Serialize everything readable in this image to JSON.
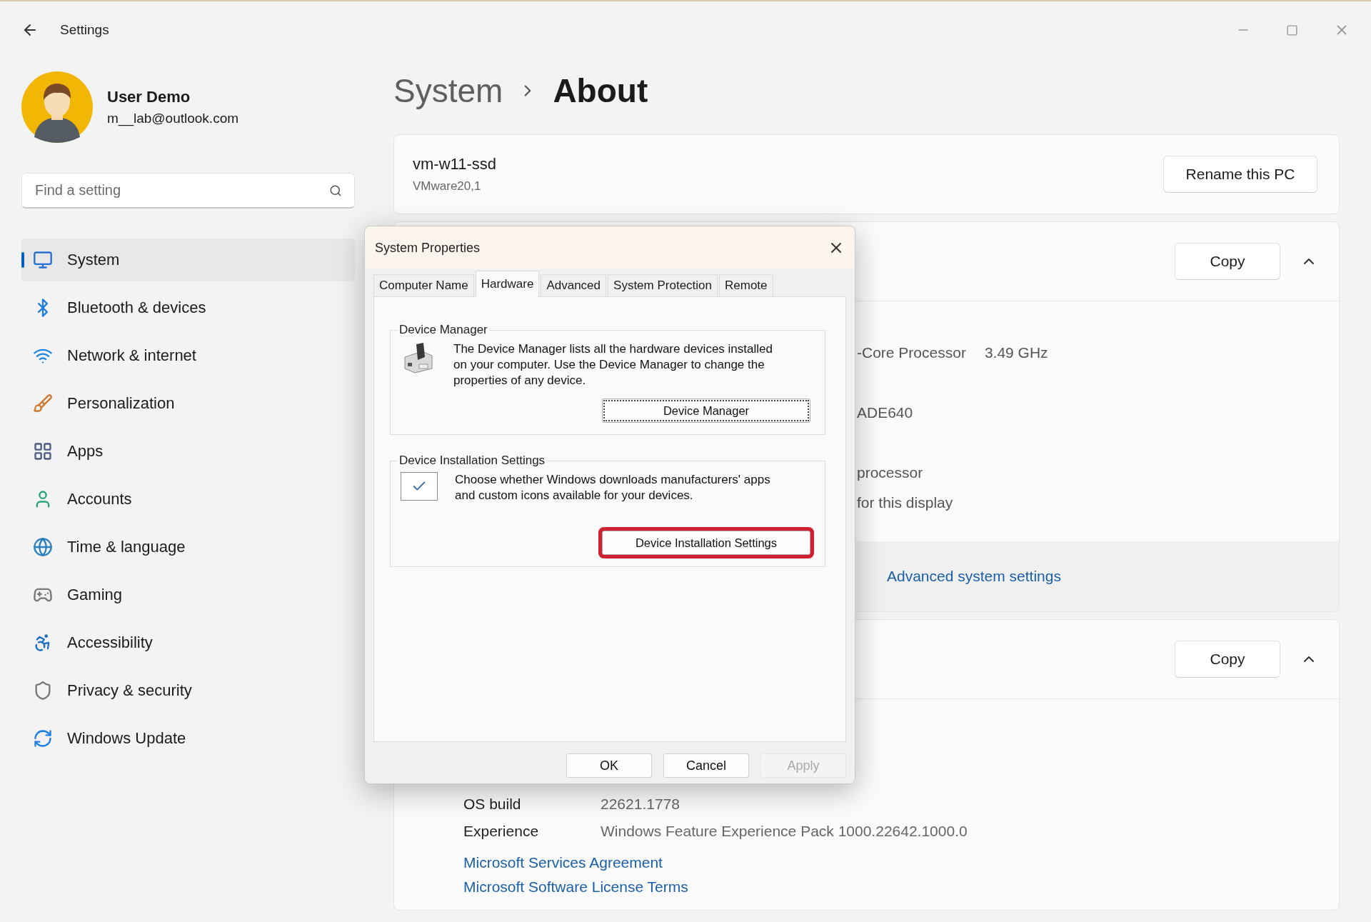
{
  "window": {
    "title": "Settings"
  },
  "user": {
    "name": "User Demo",
    "email": "m__lab@outlook.com"
  },
  "search": {
    "placeholder": "Find a setting"
  },
  "nav": [
    {
      "label": "System",
      "selected": true
    },
    {
      "label": "Bluetooth & devices",
      "selected": false
    },
    {
      "label": "Network & internet",
      "selected": false
    },
    {
      "label": "Personalization",
      "selected": false
    },
    {
      "label": "Apps",
      "selected": false
    },
    {
      "label": "Accounts",
      "selected": false
    },
    {
      "label": "Time & language",
      "selected": false
    },
    {
      "label": "Gaming",
      "selected": false
    },
    {
      "label": "Accessibility",
      "selected": false
    },
    {
      "label": "Privacy & security",
      "selected": false
    },
    {
      "label": "Windows Update",
      "selected": false
    }
  ],
  "breadcrumb": {
    "parent": "System",
    "current": "About"
  },
  "device_card": {
    "name": "vm-w11-ssd",
    "model": "VMware20,1",
    "button": "Rename this PC"
  },
  "specs_card": {
    "button": "Copy",
    "expanded": true,
    "rows": [
      {
        "cells": [
          "-Core Processor",
          "3.49 GHz"
        ]
      },
      {
        "cells": [
          "ADE640"
        ]
      },
      {
        "cells": [
          "processor"
        ]
      },
      {
        "cells": [
          "for this display"
        ]
      }
    ],
    "link": "Advanced system settings"
  },
  "windows_card": {
    "button": "Copy",
    "expanded": true,
    "rows": [
      {
        "label": "OS build",
        "value": "22621.1778"
      },
      {
        "label": "Experience",
        "value": "Windows Feature Experience Pack 1000.22642.1000.0"
      }
    ],
    "links": [
      "Microsoft Services Agreement",
      "Microsoft Software License Terms"
    ]
  },
  "dialog": {
    "title": "System Properties",
    "tabs": [
      {
        "label": "Computer Name",
        "selected": false
      },
      {
        "label": "Hardware",
        "selected": true
      },
      {
        "label": "Advanced",
        "selected": false
      },
      {
        "label": "System Protection",
        "selected": false
      },
      {
        "label": "Remote",
        "selected": false
      }
    ],
    "groups": [
      {
        "kind": "icon",
        "title": "Device Manager",
        "text": "The Device Manager lists all the hardware devices installed on your computer. Use the Device Manager to change the properties of any device.",
        "button": {
          "label": "Device Manager",
          "focused": true,
          "highlighted": false
        }
      },
      {
        "kind": "checkbox",
        "checked": true,
        "title": "Device Installation Settings",
        "text": "Choose whether Windows downloads manufacturers' apps and custom icons available for your devices.",
        "button": {
          "label": "Device Installation Settings",
          "focused": false,
          "highlighted": true
        }
      }
    ],
    "buttons": [
      {
        "label": "OK",
        "disabled": false
      },
      {
        "label": "Cancel",
        "disabled": false
      },
      {
        "label": "Apply",
        "disabled": true
      }
    ]
  }
}
